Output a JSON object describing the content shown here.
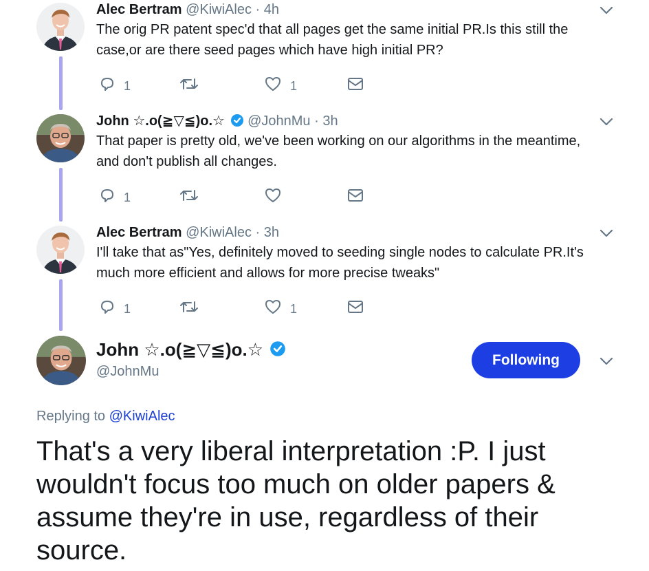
{
  "colors": {
    "accent": "#1d3ee3",
    "thread_line": "#a8a6ef",
    "muted": "#657786",
    "verified": "#1d9bf0"
  },
  "tweets": [
    {
      "name": "Alec Bertram",
      "handle": "@KiwiAlec",
      "dot": "·",
      "time": "4h",
      "verified": false,
      "text": "The orig PR patent spec'd that all pages get the same initial PR.Is this still the case,or are there seed pages which have high initial PR?",
      "reply_count": "1",
      "retweet_count": "",
      "like_count": "1"
    },
    {
      "name": "John ☆.o(≧▽≦)o.☆",
      "handle": "@JohnMu",
      "dot": "·",
      "time": "3h",
      "verified": true,
      "text": "That paper is pretty old, we've been working on our algorithms in the meantime, and don't publish all changes.",
      "reply_count": "1",
      "retweet_count": "",
      "like_count": ""
    },
    {
      "name": "Alec Bertram",
      "handle": "@KiwiAlec",
      "dot": "·",
      "time": "3h",
      "verified": false,
      "text": "I'll take that as\"Yes, definitely moved to seeding single nodes to calculate PR.It's much more efficient and allows for more precise tweaks\"",
      "reply_count": "1",
      "retweet_count": "",
      "like_count": "1"
    }
  ],
  "main_tweet": {
    "name": "John ☆.o(≧▽≦)o.☆",
    "handle": "@JohnMu",
    "verified": true,
    "follow_label": "Following",
    "replying_prefix": "Replying to",
    "replying_to": "@KiwiAlec",
    "text": "That's a very liberal interpretation :P. I just wouldn't focus too much on older papers & assume they're in use, regardless of their source."
  },
  "icons": {
    "chevron": "chevron-down-icon",
    "reply": "reply-icon",
    "retweet": "retweet-icon",
    "like": "heart-icon",
    "dm": "envelope-icon",
    "verified": "verified-badge-icon"
  }
}
